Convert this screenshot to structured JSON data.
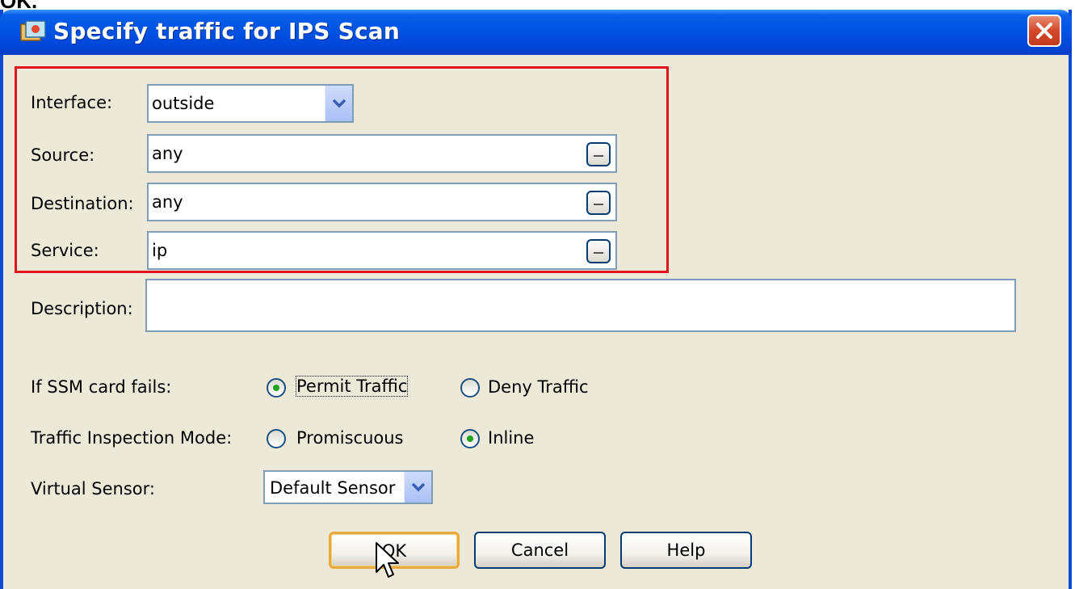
{
  "caption": "OK.",
  "dialog": {
    "title": "Specify traffic for IPS Scan",
    "interface": {
      "label": "Interface:",
      "value": "outside"
    },
    "source": {
      "label": "Source:",
      "value": "any"
    },
    "destination": {
      "label": "Destination:",
      "value": "any"
    },
    "service": {
      "label": "Service:",
      "value": "ip"
    },
    "description": {
      "label": "Description:",
      "value": ""
    },
    "ssm_fail": {
      "label": "If SSM card fails:",
      "options": [
        "Permit Traffic",
        "Deny Traffic"
      ],
      "selected": "Permit Traffic"
    },
    "inspection_mode": {
      "label": "Traffic Inspection Mode:",
      "options": [
        "Promiscuous",
        "Inline"
      ],
      "selected": "Inline"
    },
    "virtual_sensor": {
      "label": "Virtual Sensor:",
      "value": "Default Sensor"
    },
    "buttons": {
      "ok": "OK",
      "cancel": "Cancel",
      "help": "Help"
    }
  },
  "icons": [
    "app-icon",
    "close-icon",
    "chevron-down-icon",
    "browse-icon",
    "mouse-cursor-icon"
  ],
  "colors": {
    "titlebar": "#0055e5",
    "highlight_box": "#e1131f",
    "dialog_bg": "#ece9d8"
  }
}
